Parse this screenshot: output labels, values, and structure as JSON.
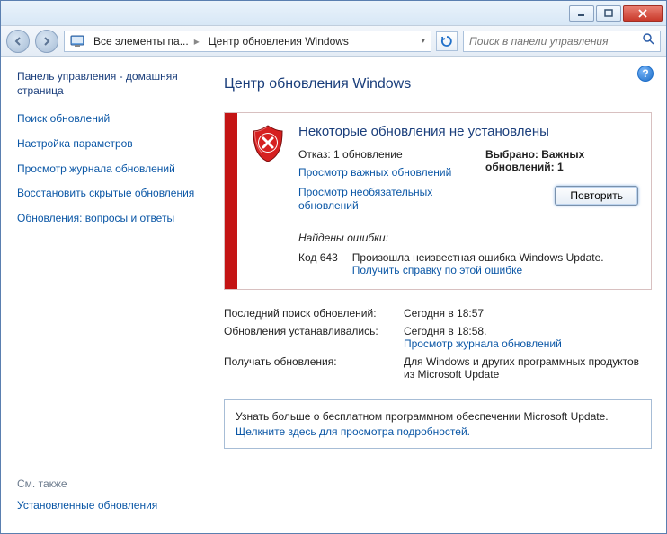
{
  "breadcrumbs": {
    "seg1": "Все элементы па...",
    "seg2": "Центр обновления Windows"
  },
  "search": {
    "placeholder": "Поиск в панели управления"
  },
  "sidebar": {
    "home": "Панель управления - домашняя страница",
    "links": [
      "Поиск обновлений",
      "Настройка параметров",
      "Просмотр журнала обновлений",
      "Восстановить скрытые обновления",
      "Обновления: вопросы и ответы"
    ],
    "see_also_label": "См. также",
    "see_also_link": "Установленные обновления"
  },
  "main": {
    "title": "Центр обновления Windows",
    "status_title": "Некоторые обновления не установлены",
    "refusal": "Отказ: 1 обновление",
    "link_important": "Просмотр важных обновлений",
    "link_optional": "Просмотр необязательных обновлений",
    "selected_label": "Выбрано: Важных обновлений: 1",
    "retry": "Повторить",
    "errors_title": "Найдены ошибки:",
    "error_code": "Код 643",
    "error_msg": "Произошла неизвестная ошибка Windows Update.",
    "error_help": "Получить справку по этой ошибке",
    "info": {
      "last_search_label": "Последний поиск обновлений:",
      "last_search_value": "Сегодня в 18:57",
      "installed_label": "Обновления устанавливались:",
      "installed_value": "Сегодня в 18:58.",
      "history_link": "Просмотр журнала обновлений",
      "receive_label": "Получать обновления:",
      "receive_value": "Для Windows и других программных продуктов из Microsoft Update"
    },
    "promo_text": "Узнать больше о бесплатном программном обеспечении Microsoft Update.",
    "promo_link": "Щелкните здесь для просмотра подробностей."
  }
}
